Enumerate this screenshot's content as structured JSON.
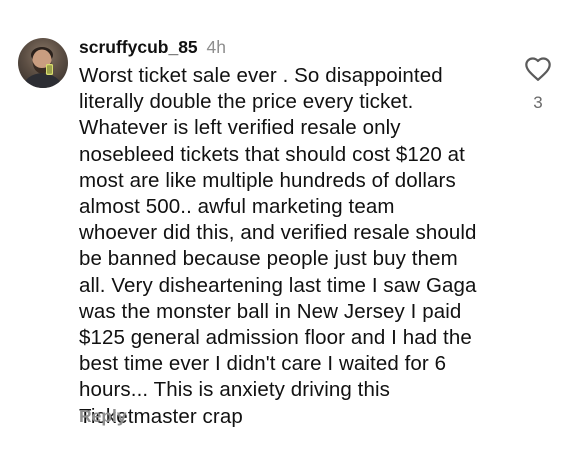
{
  "comment": {
    "username": "scruffycub_85",
    "timestamp": "4h",
    "text": "Worst ticket sale ever . So disappointed\nliterally double the price every ticket.\nWhatever is left verified resale only\nnosebleed tickets that should cost $120 at\nmost are like multiple hundreds of dollars\nalmost 500.. awful marketing team\nwhoever did this, and verified resale should\nbe banned because people just buy them\nall. Very disheartening last time I saw Gaga\nwas the monster ball in New Jersey I paid\n$125 general admission floor and I had the\nbest time ever I didn't care I waited for 6\nhours... This is anxiety driving this\nTicketmaster crap",
    "reply_label": "Reply",
    "like_count": "3",
    "like_icon": "heart-outline-icon"
  },
  "colors": {
    "text": "#111111",
    "muted": "#8e8e8e",
    "background": "#ffffff"
  }
}
